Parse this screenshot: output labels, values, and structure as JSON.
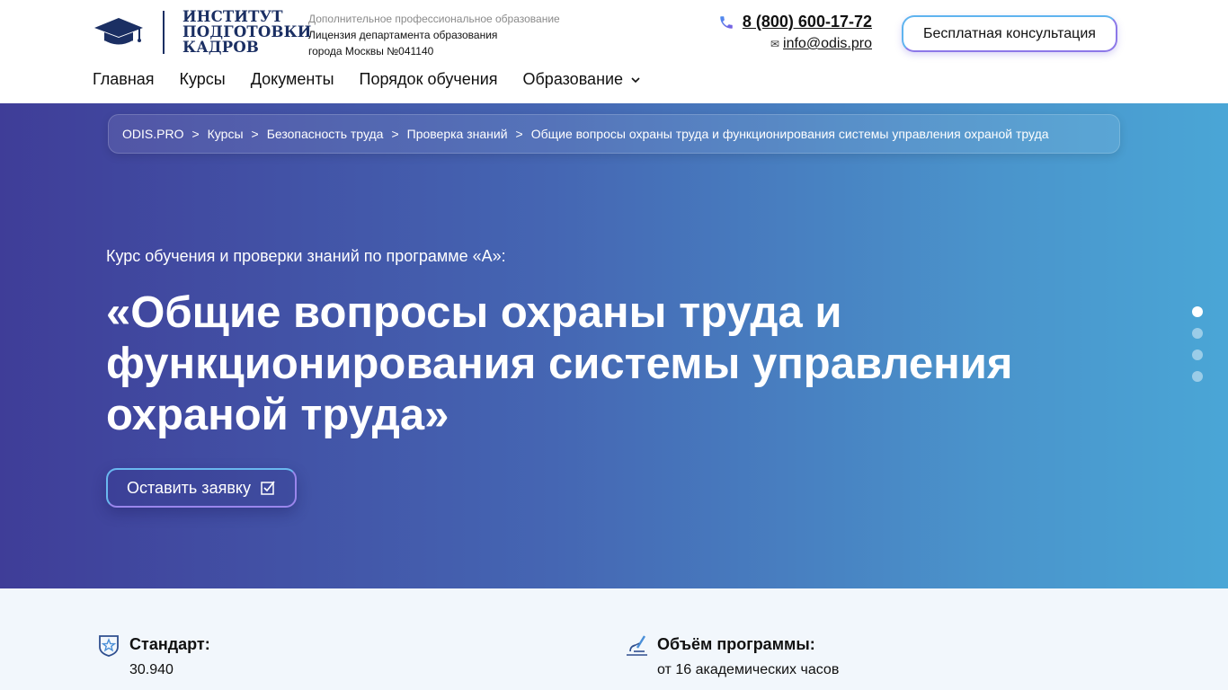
{
  "header": {
    "logo": {
      "line1": "ИНСТИТУТ",
      "line2": "ПОДГОТОВКИ",
      "line3": "КАДРОВ"
    },
    "license": {
      "line1": "Дополнительное профессиональное образование",
      "line2": "Лицензия департамента образования",
      "line3": "города Москвы №041140"
    },
    "phone": "8 (800) 600-17-72",
    "email": "info@odis.pro",
    "consult_label": "Бесплатная консультация"
  },
  "nav": {
    "items": [
      {
        "label": "Главная"
      },
      {
        "label": "Курсы"
      },
      {
        "label": "Документы"
      },
      {
        "label": "Порядок обучения"
      },
      {
        "label": "Образование"
      }
    ]
  },
  "breadcrumbs": [
    "ODIS.PRO",
    "Курсы",
    "Безопасность труда",
    "Проверка знаний",
    "Общие вопросы охраны труда и функционирования системы управления охраной труда"
  ],
  "breadcrumb_separator": ">",
  "hero": {
    "subtitle": "Курс обучения и проверки знаний по программе «А»:",
    "title": "«Общие вопросы охраны труда и функционирования системы управления охраной труда»",
    "apply_label": "Оставить заявку",
    "slides": {
      "count": 4,
      "active": 0
    }
  },
  "info": {
    "standard": {
      "label": "Стандарт:",
      "value": "30.940"
    },
    "volume": {
      "label": "Объём программы:",
      "value": "от 16 академических часов"
    }
  },
  "colors": {
    "brand_navy": "#1b2f63",
    "hero_start": "#3f3d98",
    "hero_end": "#4aa6d6",
    "accent_blue": "#5fb4ef",
    "accent_violet": "#8c78e8"
  },
  "icons": {
    "logo": "graduation-cap-icon",
    "phone": "phone-icon",
    "mail": "mail-icon",
    "dropdown": "chevron-down-icon",
    "apply": "checkbox-icon",
    "standard": "shield-star-icon",
    "volume": "microscope-icon"
  }
}
